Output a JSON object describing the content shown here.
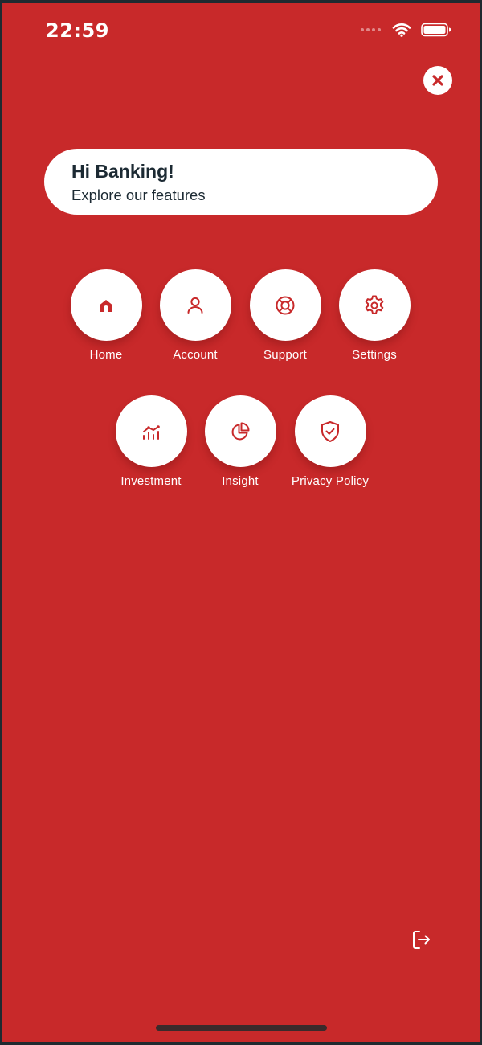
{
  "status_bar": {
    "time": "22:59",
    "icons": [
      "signal-dots-icon",
      "wifi-icon",
      "battery-icon"
    ]
  },
  "close_button": {
    "icon": "close-icon"
  },
  "greeting": {
    "title": "Hi Banking!",
    "subtitle": "Explore our features"
  },
  "menu": {
    "items": [
      {
        "label": "Home",
        "icon": "home-icon"
      },
      {
        "label": "Account",
        "icon": "user-icon"
      },
      {
        "label": "Support",
        "icon": "lifebuoy-icon"
      },
      {
        "label": "Settings",
        "icon": "gear-icon"
      },
      {
        "label": "Investment",
        "icon": "investment-chart-icon"
      },
      {
        "label": "Insight",
        "icon": "pie-chart-icon"
      },
      {
        "label": "Privacy Policy",
        "icon": "shield-check-icon"
      }
    ]
  },
  "logout_button": {
    "icon": "logout-icon"
  },
  "colors": {
    "background": "#c8292a",
    "card": "#ffffff",
    "text_dark": "#1c2a33",
    "accent": "#c8292a"
  }
}
